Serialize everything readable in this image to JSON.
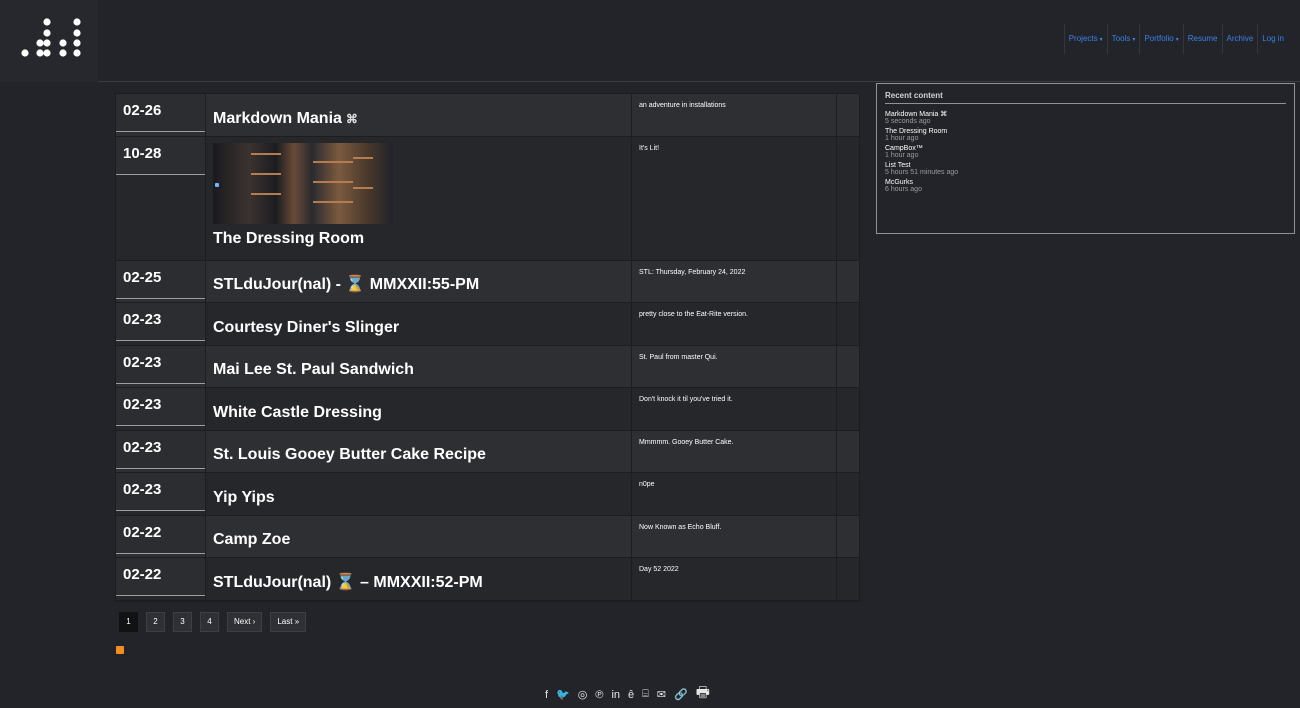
{
  "nav": {
    "items": [
      {
        "label": "Projects",
        "dropdown": true
      },
      {
        "label": "Tools",
        "dropdown": true
      },
      {
        "label": "Portfolio",
        "dropdown": true
      },
      {
        "label": "Resume",
        "dropdown": false
      },
      {
        "label": "Archive",
        "dropdown": false
      },
      {
        "label": "Log in",
        "dropdown": false
      }
    ]
  },
  "rows": [
    {
      "date": "02-26",
      "title": "Markdown Mania",
      "title_icon": "⌘",
      "desc": "an adventure in installations",
      "has_image": false
    },
    {
      "date": "10-28",
      "title": "The Dressing Room",
      "title_icon": "",
      "desc": "It's Lit!",
      "has_image": true
    },
    {
      "date": "02-25",
      "title": "STLduJour(nal) - ⌛ MMXXII:55-PM",
      "title_icon": "",
      "desc": "STL: Thursday, February 24, 2022",
      "has_image": false
    },
    {
      "date": "02-23",
      "title": "Courtesy Diner's Slinger",
      "title_icon": "",
      "desc": "pretty close to the Eat-Rite version.",
      "has_image": false
    },
    {
      "date": "02-23",
      "title": "Mai Lee St. Paul Sandwich",
      "title_icon": "",
      "desc": "St. Paul from master Qui.",
      "has_image": false
    },
    {
      "date": "02-23",
      "title": "White Castle Dressing",
      "title_icon": "",
      "desc": "Don't knock it til you've tried it.",
      "has_image": false
    },
    {
      "date": "02-23",
      "title": "St. Louis Gooey Butter Cake Recipe",
      "title_icon": "",
      "desc": "Mmmmm. Gooey Butter Cake.",
      "has_image": false
    },
    {
      "date": "02-23",
      "title": "Yip Yips",
      "title_icon": "",
      "desc": "n0pe",
      "has_image": false
    },
    {
      "date": "02-22",
      "title": "Camp Zoe",
      "title_icon": "",
      "desc": "Now Known as Echo Bluff.",
      "has_image": false
    },
    {
      "date": "02-22",
      "title": "STLduJour(nal) ⌛ – MMXXII:52-PM",
      "title_icon": "",
      "desc": "Day 52 2022",
      "has_image": false
    }
  ],
  "pager": {
    "pages": [
      "1",
      "2",
      "3",
      "4"
    ],
    "current": "1",
    "next_label": "Next ›",
    "last_label": "Last »"
  },
  "sidebar": {
    "title": "Recent content",
    "items": [
      {
        "label": "Markdown Mania ⌘",
        "time": "5 seconds ago"
      },
      {
        "label": "The Dressing Room",
        "time": "1 hour ago"
      },
      {
        "label": "CampBox™",
        "time": "1 hour ago"
      },
      {
        "label": "List Test",
        "time": "5 hours 51 minutes ago"
      },
      {
        "label": "McGurks",
        "time": "6 hours ago"
      }
    ]
  },
  "share": {
    "icons": [
      {
        "name": "facebook-icon",
        "glyph": "f"
      },
      {
        "name": "twitter-icon",
        "glyph": "🐦"
      },
      {
        "name": "whatsapp-icon",
        "glyph": "◎"
      },
      {
        "name": "pinterest-icon",
        "glyph": "℗"
      },
      {
        "name": "linkedin-icon",
        "glyph": "in"
      },
      {
        "name": "evernote-icon",
        "glyph": "ȇ"
      },
      {
        "name": "pocket-icon",
        "glyph": "⌸"
      },
      {
        "name": "email-icon",
        "glyph": "✉"
      },
      {
        "name": "link-icon",
        "glyph": "🔗"
      },
      {
        "name": "print-icon",
        "glyph": "🖶"
      }
    ]
  },
  "colors": {
    "background": "#222429",
    "nav_link": "#3b82e6",
    "rss": "#f38d1e"
  }
}
